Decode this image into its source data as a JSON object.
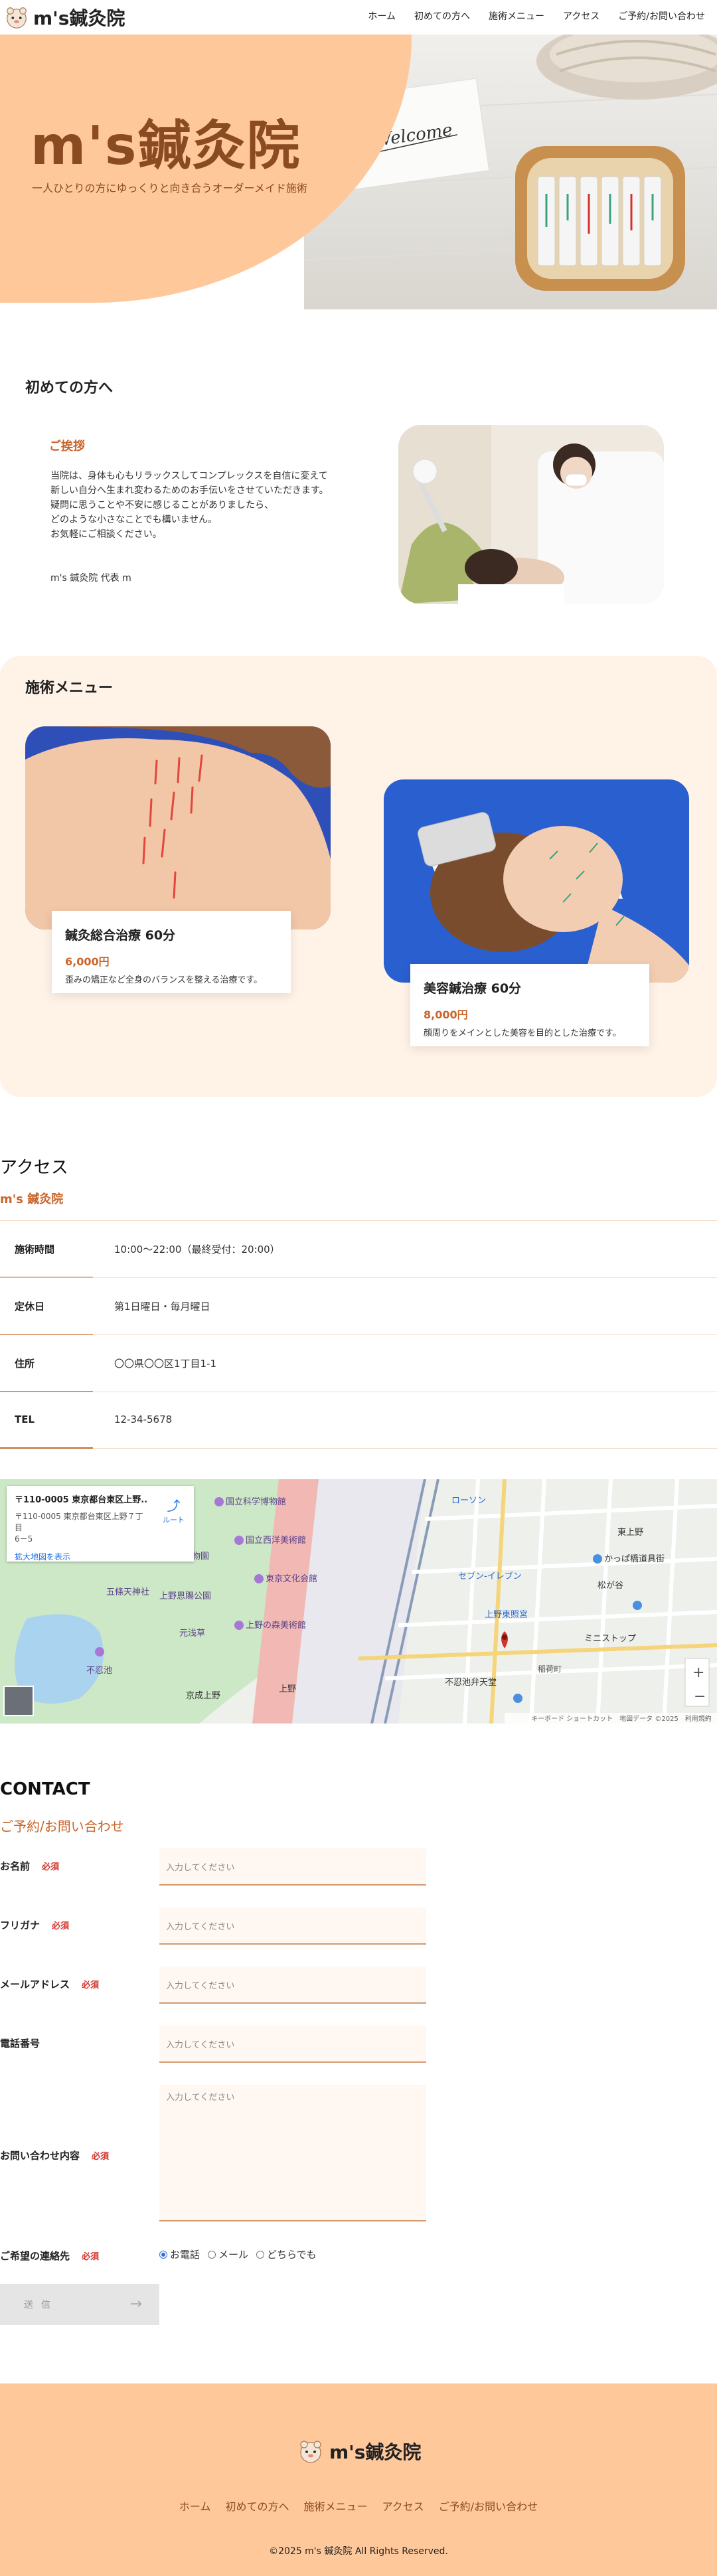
{
  "header": {
    "logo_text": "m's鍼灸院",
    "nav": [
      "ホーム",
      "初めての方へ",
      "施術メニュー",
      "アクセス",
      "ご予約/お問い合わせ"
    ]
  },
  "hero": {
    "title": "m's鍼灸院",
    "subtitle": "一人ひとりの方にゆっくりと向き合うオーダーメイド施術",
    "card_text": "Welcome"
  },
  "intro": {
    "title": "初めての方へ",
    "greeting_heading": "ご挨拶",
    "greeting_lines": [
      "当院は、身体も心もリラックスしてコンプレックスを自信に変えて",
      "新しい自分へ生まれ変わるためのお手伝いをさせていただきます。",
      "疑問に思うことや不安に感じることがありましたら、",
      "どのような小さなことでも構いません。",
      "お気軽にご相談ください。"
    ],
    "signature": "m's 鍼灸院 代表 m"
  },
  "menu": {
    "title": "施術メニュー",
    "items": [
      {
        "name": "鍼灸総合治療 60分",
        "price": "6,000円",
        "desc": "歪みの矯正など全身のバランスを整える治療です。"
      },
      {
        "name": "美容鍼治療 60分",
        "price": "8,000円",
        "desc": "顔周りをメインとした美容を目的とした治療です。"
      }
    ]
  },
  "access": {
    "title": "アクセス",
    "subtitle": "m's 鍼灸院",
    "rows": [
      {
        "key": "施術時間",
        "value": "10:00〜22:00（最終受付：20:00）"
      },
      {
        "key": "定休日",
        "value": "第1日曜日・毎月曜日"
      },
      {
        "key": "住所",
        "value": "〇〇県〇〇区1丁目1-1"
      },
      {
        "key": "TEL",
        "value": "12-34-5678"
      }
    ],
    "map": {
      "place_title": "〒110-0005 東京都台東区上野...",
      "place_addr1": "〒110-0005 東京都台東区上野７丁目",
      "place_addr2": "6－5",
      "route_label": "ルート",
      "larger_map": "拡大地図を表示",
      "attribution": "キーボード ショートカット　地図データ ©2025　利用規約",
      "labels": [
        "国立科学博物館",
        "国立西洋美術館",
        "東京文化会館",
        "上野恩賜公園",
        "上野の森美術館",
        "不忍池",
        "五條天神社",
        "京成上野",
        "上野",
        "かっぱ橋道具街",
        "松が谷",
        "元浅草",
        "ローソン",
        "セブン-イレブン",
        "稲荷町",
        "不忍池弁天堂",
        "上野東照宮",
        "上野動物園",
        "ミニストップ",
        "東上野"
      ]
    }
  },
  "contact": {
    "title": "CONTACT",
    "subtitle": "ご予約/お問い合わせ",
    "required": "必須",
    "placeholder": "入力してください",
    "fields": [
      "お名前",
      "フリガナ",
      "メールアドレス",
      "電話番号",
      "お問い合わせ内容",
      "ご希望の連絡先"
    ],
    "radio_options": [
      "お電話",
      "メール",
      "どちらでも"
    ],
    "submit_label": "送信",
    "submit_arrow": "→"
  },
  "footer": {
    "logo_text": "m's鍼灸院",
    "nav": [
      "ホーム",
      "初めての方へ",
      "施術メニュー",
      "アクセス",
      "ご予約/お問い合わせ"
    ],
    "copyright": "©2025 m's 鍼灸院 All Rights Reserved."
  },
  "colors": {
    "accent": "#ffc89b",
    "brown": "#8a4a22",
    "orange": "#c9652a",
    "menu_bg": "#fff2e6"
  }
}
